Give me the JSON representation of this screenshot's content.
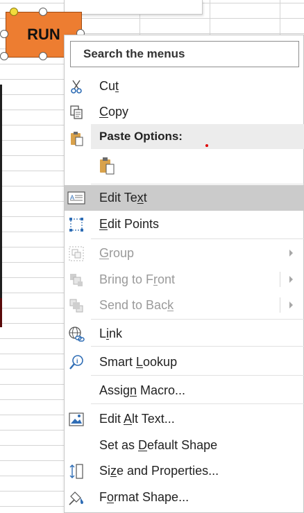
{
  "shape": {
    "label": "RUN",
    "fill_color": "#ed7d31"
  },
  "menu": {
    "search_placeholder": "Search the menus",
    "items": [
      {
        "pre": "Cu",
        "key": "t",
        "post": "",
        "icon": "scissors-icon",
        "enabled": true
      },
      {
        "pre": "",
        "key": "C",
        "post": "opy",
        "icon": "copy-icon",
        "enabled": true
      },
      {
        "label": "Paste Options:",
        "icon": "paste-icon",
        "section": true
      },
      {
        "pre": "Edit Te",
        "key": "x",
        "post": "t",
        "icon": "edit-text-icon",
        "enabled": true,
        "highlighted": true
      },
      {
        "pre": "",
        "key": "E",
        "post": "dit Points",
        "icon": "edit-points-icon",
        "enabled": true
      },
      {
        "pre": "",
        "key": "G",
        "post": "roup",
        "icon": "group-icon",
        "enabled": false,
        "submenu": true
      },
      {
        "pre": "Bring to F",
        "key": "r",
        "post": "ont",
        "icon": "bring-to-front-icon",
        "enabled": false,
        "submenu": true
      },
      {
        "pre": "Send to Bac",
        "key": "k",
        "post": "",
        "icon": "send-to-back-icon",
        "enabled": false,
        "submenu": true
      },
      {
        "pre": "L",
        "key": "i",
        "post": "nk",
        "icon": "link-icon",
        "enabled": true
      },
      {
        "pre": "Smart ",
        "key": "L",
        "post": "ookup",
        "icon": "smart-lookup-icon",
        "enabled": true
      },
      {
        "pre": "Assig",
        "key": "n",
        "post": " Macro...",
        "icon": "",
        "enabled": true
      },
      {
        "pre": "Edit ",
        "key": "A",
        "post": "lt Text...",
        "icon": "alt-text-icon",
        "enabled": true
      },
      {
        "pre": "Set as ",
        "key": "D",
        "post": "efault Shape",
        "icon": "",
        "enabled": true
      },
      {
        "pre": "Si",
        "key": "z",
        "post": "e and Properties...",
        "icon": "size-properties-icon",
        "enabled": true
      },
      {
        "pre": "F",
        "key": "o",
        "post": "rmat Shape...",
        "icon": "format-shape-icon",
        "enabled": true
      }
    ]
  }
}
